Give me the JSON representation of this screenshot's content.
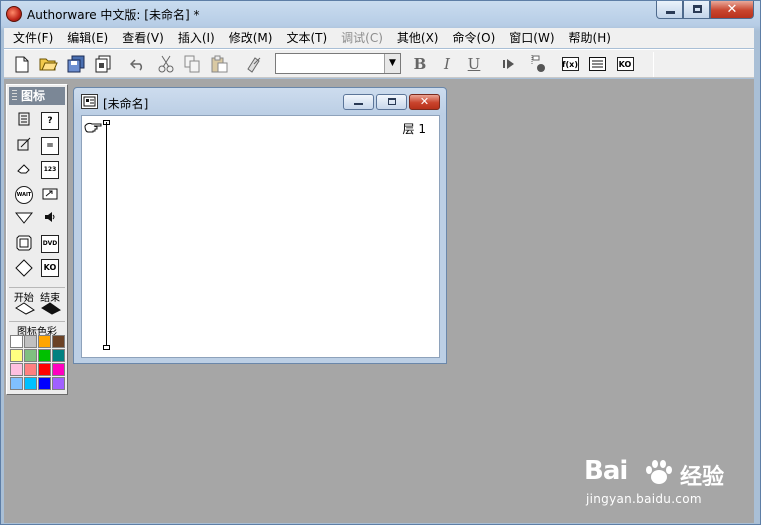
{
  "app": {
    "title": "Authorware 中文版: [未命名] *"
  },
  "menubar": {
    "items": [
      {
        "label": "文件(F)",
        "enabled": true
      },
      {
        "label": "编辑(E)",
        "enabled": true
      },
      {
        "label": "查看(V)",
        "enabled": true
      },
      {
        "label": "插入(I)",
        "enabled": true
      },
      {
        "label": "修改(M)",
        "enabled": true
      },
      {
        "label": "文本(T)",
        "enabled": true
      },
      {
        "label": "调试(C)",
        "enabled": false
      },
      {
        "label": "其他(X)",
        "enabled": true
      },
      {
        "label": "命令(O)",
        "enabled": true
      },
      {
        "label": "窗口(W)",
        "enabled": true
      },
      {
        "label": "帮助(H)",
        "enabled": true
      }
    ]
  },
  "toolbar": {
    "font_select_value": "",
    "bold_label": "B",
    "italic_label": "I",
    "underline_label": "U",
    "functions_label": "f(x)",
    "knowledge_label": "KO"
  },
  "palette": {
    "header": "图标",
    "icons": [
      {
        "name": "display-icon",
        "label": ""
      },
      {
        "name": "interaction-icon",
        "label": "?"
      },
      {
        "name": "motion-icon",
        "label": ""
      },
      {
        "name": "calculation-icon",
        "label": "="
      },
      {
        "name": "erase-icon",
        "label": ""
      },
      {
        "name": "navigate-icon",
        "label": "123"
      },
      {
        "name": "wait-icon",
        "label": "WAIT"
      },
      {
        "name": "digital-movie-icon",
        "label": ""
      },
      {
        "name": "decision-icon",
        "label": ""
      },
      {
        "name": "sound-icon",
        "label": ""
      },
      {
        "name": "framework-icon",
        "label": ""
      },
      {
        "name": "video-icon",
        "label": "DVD"
      },
      {
        "name": "map-icon",
        "label": ""
      },
      {
        "name": "knowledge-object-icon",
        "label": "KO"
      }
    ],
    "flags_label_start": "开始",
    "flags_label_end": "结束",
    "colors_label": "图标色彩",
    "colors": [
      "#ffffff",
      "#c0c0c0",
      "#ffa500",
      "#6b4226",
      "#ffff80",
      "#80c080",
      "#00c000",
      "#008080",
      "#ffc0e0",
      "#ff8080",
      "#ff0000",
      "#ff00c0",
      "#80c0ff",
      "#00c0ff",
      "#0000ff",
      "#a060ff"
    ]
  },
  "document": {
    "title": "[未命名]",
    "layer_label": "层 1"
  },
  "watermark": {
    "brand": "Bai",
    "brand_cn": "经验",
    "url": "jingyan.baidu.com"
  }
}
